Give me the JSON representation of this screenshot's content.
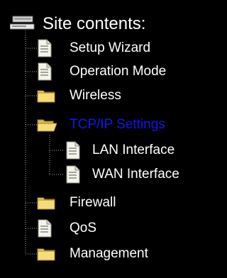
{
  "tree": {
    "root": {
      "label": "Site contents:",
      "icon": "computer-icon"
    },
    "items": [
      {
        "label": "Setup Wizard",
        "icon": "page-icon",
        "type": "page"
      },
      {
        "label": "Operation Mode",
        "icon": "page-icon",
        "type": "page"
      },
      {
        "label": "Wireless",
        "icon": "folder-closed-icon",
        "type": "folder"
      },
      {
        "label": "TCP/IP Settings",
        "icon": "folder-open-icon",
        "type": "folder",
        "state": "open",
        "active": true,
        "children": [
          {
            "label": "LAN Interface",
            "icon": "page-icon",
            "type": "page"
          },
          {
            "label": "WAN Interface",
            "icon": "page-icon",
            "type": "page"
          }
        ]
      },
      {
        "label": "Firewall",
        "icon": "folder-closed-icon",
        "type": "folder"
      },
      {
        "label": "QoS",
        "icon": "page-icon",
        "type": "page"
      },
      {
        "label": "Management",
        "icon": "folder-closed-icon",
        "type": "folder"
      }
    ]
  },
  "colors": {
    "background": "#000000",
    "text": "#ffffff",
    "active_text": "#1414f0",
    "folder": "#f0d060",
    "page": "#f4f4e8",
    "tree_lines": "#a8a8a8"
  }
}
